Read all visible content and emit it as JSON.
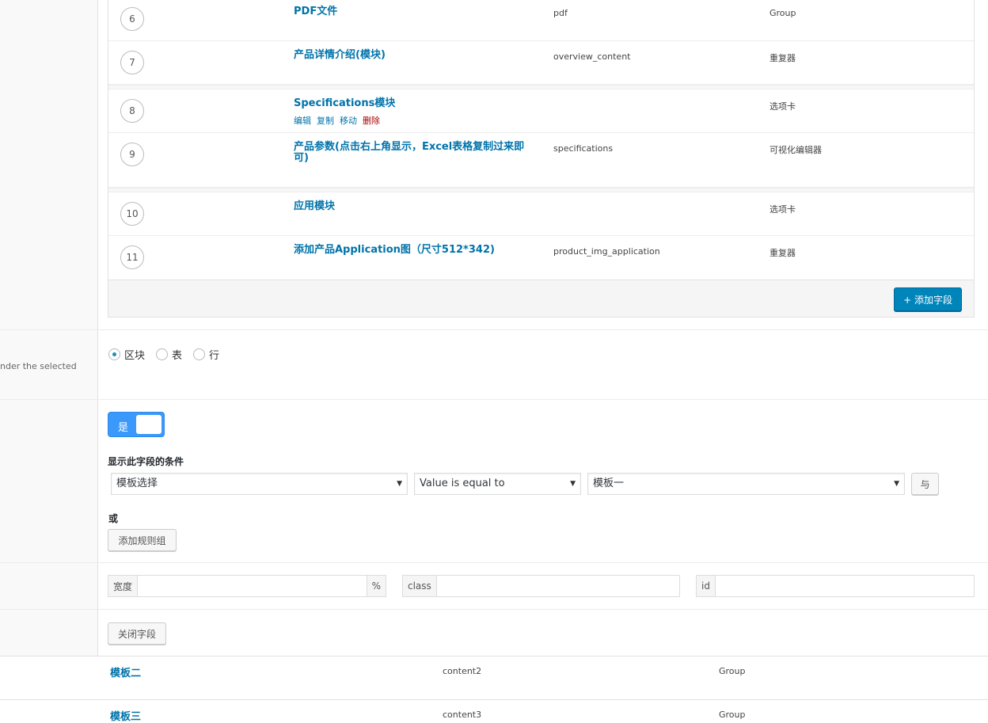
{
  "subfields": [
    {
      "order": "6",
      "label": "PDF文件",
      "name": "pdf",
      "type": "Group"
    },
    {
      "order": "7",
      "label": "产品详情介绍(模块)",
      "name": "overview_content",
      "type": "重复器"
    },
    {
      "order": "8",
      "label": "Specifications模块",
      "name": "",
      "type": "选项卡",
      "actions": {
        "edit": "编辑",
        "copy": "复制",
        "move": "移动",
        "delete": "删除"
      }
    },
    {
      "order": "9",
      "label": "产品参数(点击右上角显示，Excel表格复制过来即可)",
      "name": "specifications",
      "type": "可视化编辑器"
    },
    {
      "order": "10",
      "label": "应用模块",
      "name": "",
      "type": "选项卡"
    },
    {
      "order": "11",
      "label": "添加产品Application图（尺寸512*342)",
      "name": "product_img_application",
      "type": "重复器"
    }
  ],
  "add_field_label": "+ 添加字段",
  "layout_setting": {
    "left_label": "nder the selected",
    "options": [
      {
        "label": "区块",
        "checked": true
      },
      {
        "label": "表",
        "checked": false
      },
      {
        "label": "行",
        "checked": false
      }
    ]
  },
  "conditional": {
    "toggle_label": "是",
    "title": "显示此字段的条件",
    "rule": {
      "field": "模板选择",
      "operator": "Value is equal to",
      "value": "模板一"
    },
    "and_label": "与",
    "or_label": "或",
    "add_group_label": "添加规则组"
  },
  "wrapper": {
    "width_label": "宽度",
    "width_unit": "%",
    "class_label": "class",
    "id_label": "id"
  },
  "close_field_label": "关闭字段",
  "outer_fields": [
    {
      "label": "模板二",
      "name": "content2",
      "type": "Group"
    },
    {
      "label": "模板三",
      "name": "content3",
      "type": "Group"
    }
  ],
  "colors": {
    "accent": "#0073aa",
    "primary_button": "#0085ba",
    "toggle": "#3b99fc",
    "delete": "#a00"
  }
}
